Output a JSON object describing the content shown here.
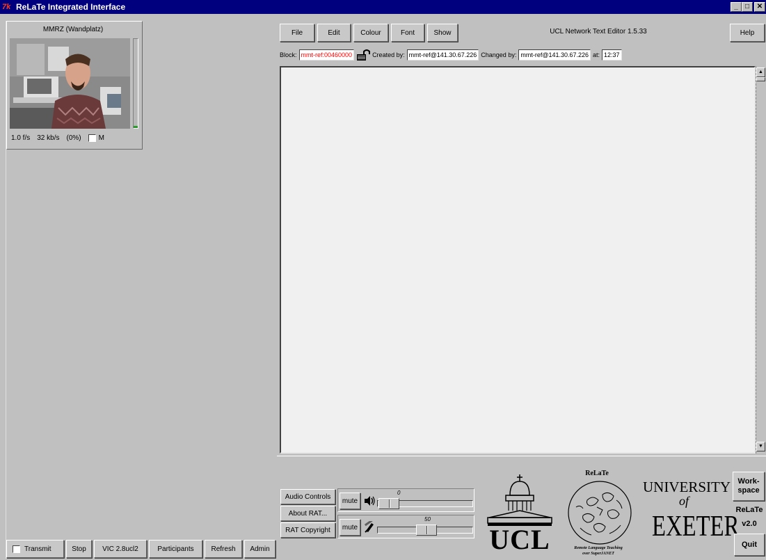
{
  "window": {
    "title": "ReLaTe Integrated Interface",
    "icon_text": "7k",
    "controls": [
      "minimize",
      "maximize",
      "close"
    ]
  },
  "video": {
    "participant": "MMRZ (Wandplatz)",
    "frame_rate": "1.0 f/s",
    "bitrate": "32 kb/s",
    "loss": "(0%)",
    "mute_label": "M",
    "mute_checked": false
  },
  "left_toolbar": {
    "transmit_label": "Transmit",
    "transmit_checked": false,
    "stop_label": "Stop",
    "version_label": "VIC 2.8ucl2",
    "participants_label": "Participants",
    "refresh_label": "Refresh",
    "admin_label": "Admin"
  },
  "editor_menu": {
    "file": "File",
    "edit": "Edit",
    "colour": "Colour",
    "font": "Font",
    "show": "Show",
    "app_title": "UCL Network Text Editor 1.5.33",
    "help": "Help"
  },
  "editor_status": {
    "block_label": "Block:",
    "block_value": "mmt-ref:00460000",
    "created_label": "Created by:",
    "created_value": "mmt-ref@141.30.67.226",
    "changed_label": "Changed by:",
    "changed_value": "mmt-ref@141.30.67.226",
    "at_label": "at:",
    "at_value": "12:37"
  },
  "audio": {
    "audio_controls_label": "Audio Controls",
    "about_rat_label": "About RAT...",
    "rat_copyright_label": "RAT Copyright",
    "speaker_mute_label": "mute",
    "speaker_value": "0",
    "mic_mute_label": "mute",
    "mic_value": "50"
  },
  "logos": {
    "ucl_text": "UCL",
    "relate_title": "ReLaTe",
    "relate_caption_1": "Remote Language Teaching",
    "relate_caption_2": "over SuperJANET",
    "exeter_line1": "UNIVERSITY",
    "exeter_line2": "of",
    "exeter_line3": "EXETER"
  },
  "side_buttons": {
    "workspace_label_1": "Work-",
    "workspace_label_2": "space",
    "relate_label": "ReLaTe",
    "version_label": "v2.0",
    "quit_label": "Quit"
  }
}
